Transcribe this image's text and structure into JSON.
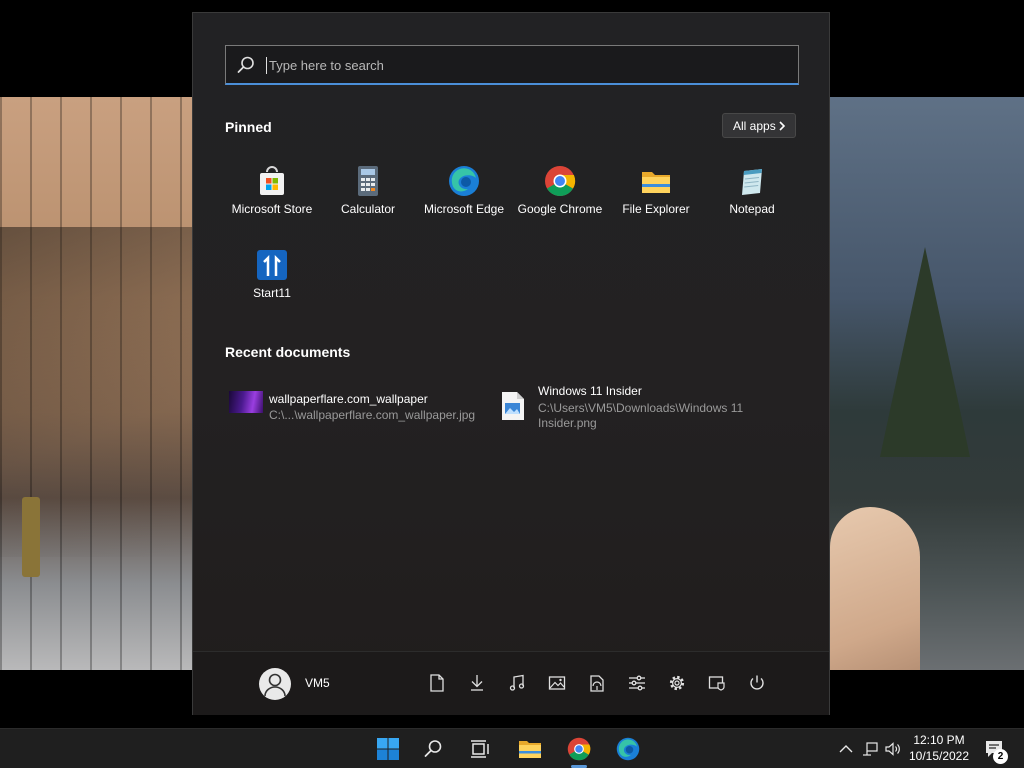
{
  "colors": {
    "menu_bg": "#222224",
    "accent": "#4b8fd8",
    "taskbar_bg": "#1f1f1f"
  },
  "search": {
    "placeholder": "Type here to search",
    "value": ""
  },
  "pinned": {
    "title": "Pinned",
    "all_apps_label": "All apps",
    "items": [
      {
        "label": "Microsoft Store",
        "icon": "microsoft-store-icon"
      },
      {
        "label": "Calculator",
        "icon": "calculator-icon"
      },
      {
        "label": "Microsoft Edge",
        "icon": "edge-icon"
      },
      {
        "label": "Google Chrome",
        "icon": "chrome-icon"
      },
      {
        "label": "File Explorer",
        "icon": "folder-icon"
      },
      {
        "label": "Notepad",
        "icon": "notepad-icon"
      },
      {
        "label": "Start11",
        "icon": "start11-icon"
      }
    ]
  },
  "recent": {
    "title": "Recent documents",
    "items": [
      {
        "name": "wallpaperflare.com_wallpaper",
        "path": "C:\\...\\wallpaperflare.com_wallpaper.jpg",
        "icon": "image-thumbnail"
      },
      {
        "name": "Windows 11 Insider",
        "path": "C:\\Users\\VM5\\Downloads\\Windows 11 Insider.png",
        "icon": "image-file-icon"
      }
    ]
  },
  "user": {
    "name": "VM5"
  },
  "footer_icons": [
    "documents-icon",
    "downloads-icon",
    "music-icon",
    "pictures-icon",
    "network-icon",
    "settings-sliders-icon",
    "gear-icon",
    "tablet-icon",
    "power-icon"
  ],
  "taskbar": {
    "icons": [
      "windows-start-icon",
      "search-icon",
      "task-view-icon",
      "file-explorer-icon",
      "chrome-icon",
      "edge-icon"
    ]
  },
  "tray": {
    "time": "12:10 PM",
    "date": "10/15/2022",
    "notification_count": "2"
  }
}
